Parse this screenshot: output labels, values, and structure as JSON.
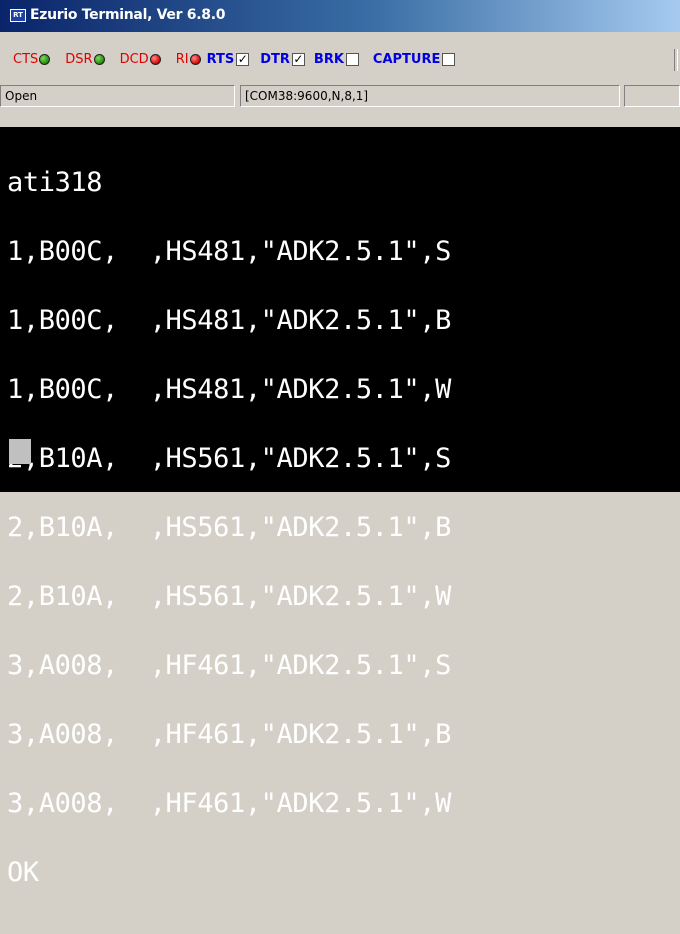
{
  "window": {
    "icon_text": "RT",
    "title": "Ezurio Terminal, Ver 6.8.0"
  },
  "signals": {
    "cts": "CTS",
    "dsr": "DSR",
    "dcd": "DCD",
    "ri": "RI",
    "rts": "RTS",
    "dtr": "DTR",
    "brk": "BRK",
    "capture": "CAPTURE"
  },
  "checkboxes": {
    "rts": true,
    "dtr": true,
    "brk": false,
    "capture": false
  },
  "leds": {
    "cts": "green",
    "dsr": "green",
    "dcd": "red",
    "ri": "red"
  },
  "status": {
    "state": "Open",
    "port": "[COM38:9600,N,8,1]"
  },
  "terminal": {
    "lines": [
      "ati318",
      "1,B00C,  ,HS481,\"ADK2.5.1\",S",
      "1,B00C,  ,HS481,\"ADK2.5.1\",B",
      "1,B00C,  ,HS481,\"ADK2.5.1\",W",
      "2,B10A,  ,HS561,\"ADK2.5.1\",S",
      "2,B10A,  ,HS561,\"ADK2.5.1\",B",
      "2,B10A,  ,HS561,\"ADK2.5.1\",W",
      "3,A008,  ,HF461,\"ADK2.5.1\",S",
      "3,A008,  ,HF461,\"ADK2.5.1\",B",
      "3,A008,  ,HF461,\"ADK2.5.1\",W",
      "OK"
    ]
  }
}
